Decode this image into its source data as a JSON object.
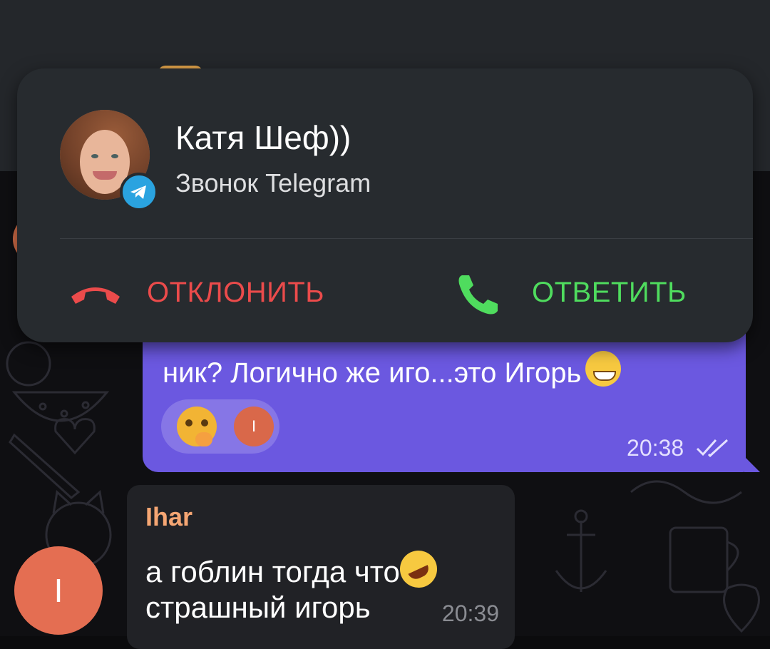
{
  "call": {
    "caller_name": "Катя Шеф))",
    "subtitle": "Звонок Telegram",
    "decline_label": "ОТКЛОНИТЬ",
    "answer_label": "ОТВЕТИТЬ",
    "decline_color": "#eb4b4b",
    "answer_color": "#4fdc5e",
    "badge_icon": "telegram-icon"
  },
  "outgoing": {
    "text": "ник? Логично же иго...это Игорь",
    "emoji_icon": "grinning-face-icon",
    "reaction_icon": "thinking-face-icon",
    "reaction_user_initial": "I",
    "time": "20:38",
    "status_icon": "double-check-icon",
    "bubble_color": "#6b58e0"
  },
  "incoming": {
    "sender": "Ihar",
    "line1": "а гоблин тогда что",
    "line2": "страшный игорь",
    "emoji_icon": "rolling-laughing-icon",
    "time": "20:39",
    "avatar_initial": "I",
    "sender_color": "#f5a673"
  }
}
